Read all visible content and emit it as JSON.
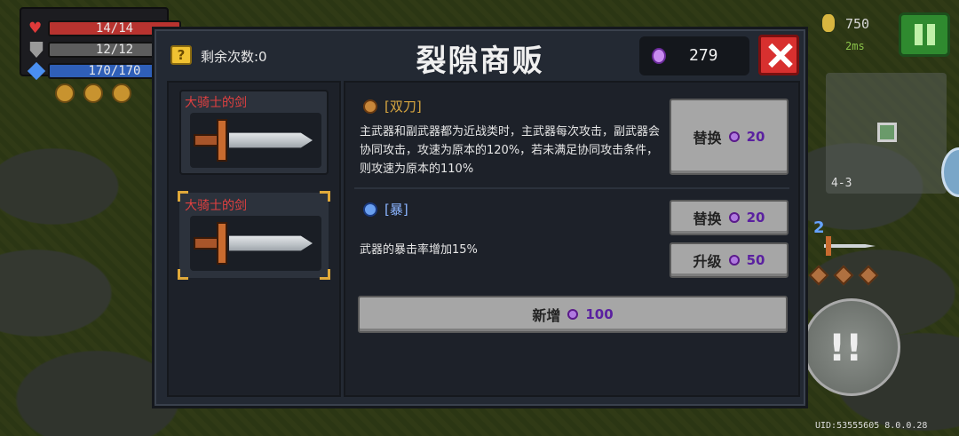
{
  "hud": {
    "hp": "14/14",
    "armor": "12/12",
    "energy": "170/170",
    "coins": "750",
    "ping": "2ms",
    "level": "4-3",
    "weapon_slot_number": "2",
    "uid": "UID:53555605 8.0.0.28"
  },
  "shop": {
    "remaining_label": "剩余次数:0",
    "title": "裂隙商贩",
    "crystals": "279",
    "weapons": [
      {
        "name": "大骑士的剑"
      },
      {
        "name": "大骑士的剑"
      }
    ],
    "traits": [
      {
        "tag": "[双刀]",
        "desc": "主武器和副武器都为近战类时，主武器每次攻击，副武器会协同攻击，攻速为原本的120%，若未满足协同攻击条件，则攻速为原本的110%",
        "replace_label": "替换",
        "replace_cost": "20"
      },
      {
        "tag": "[暴]",
        "desc": "武器的暴击率增加15%",
        "replace_label": "替换",
        "replace_cost": "20",
        "upgrade_label": "升级",
        "upgrade_cost": "50"
      }
    ],
    "add_label": "新增",
    "add_cost": "100"
  },
  "colors": {
    "panel": "#232933",
    "weapon_name": "#e04040",
    "trait1": "#d8a640",
    "trait2": "#8ab4ff",
    "crystal": "#c98bf0",
    "close": "#d8302f"
  }
}
